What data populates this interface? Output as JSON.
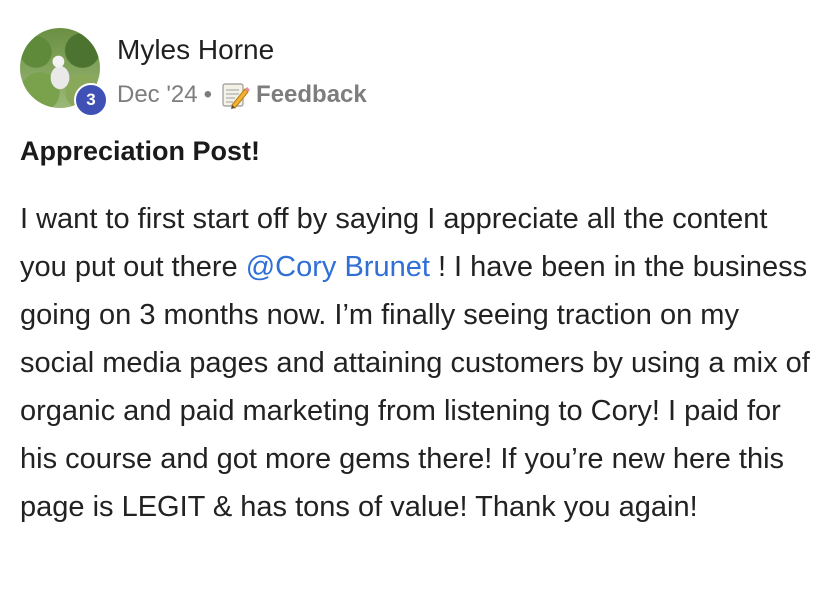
{
  "post": {
    "author": "Myles Horne",
    "level": "3",
    "date": "Dec '24",
    "separator": "•",
    "category": "Feedback",
    "category_icon": "memo-pencil-icon",
    "title": "Appreciation Post!",
    "body_part1": "I want to first start off by saying I appreciate all the content you put out there ",
    "mention": "@Cory Brunet",
    "body_part2": " ! I have been in the business going on 3 months now. I’m finally seeing traction on my social media pages and attaining customers by using a mix of organic and paid marketing from listening to Cory! I paid for his course and got more gems there! If you’re new here this page is LEGIT & has tons of value! Thank you again!"
  },
  "colors": {
    "level_badge": "#3f51b5",
    "mention": "#2f6fd6",
    "meta_text": "#7d7d7d"
  }
}
